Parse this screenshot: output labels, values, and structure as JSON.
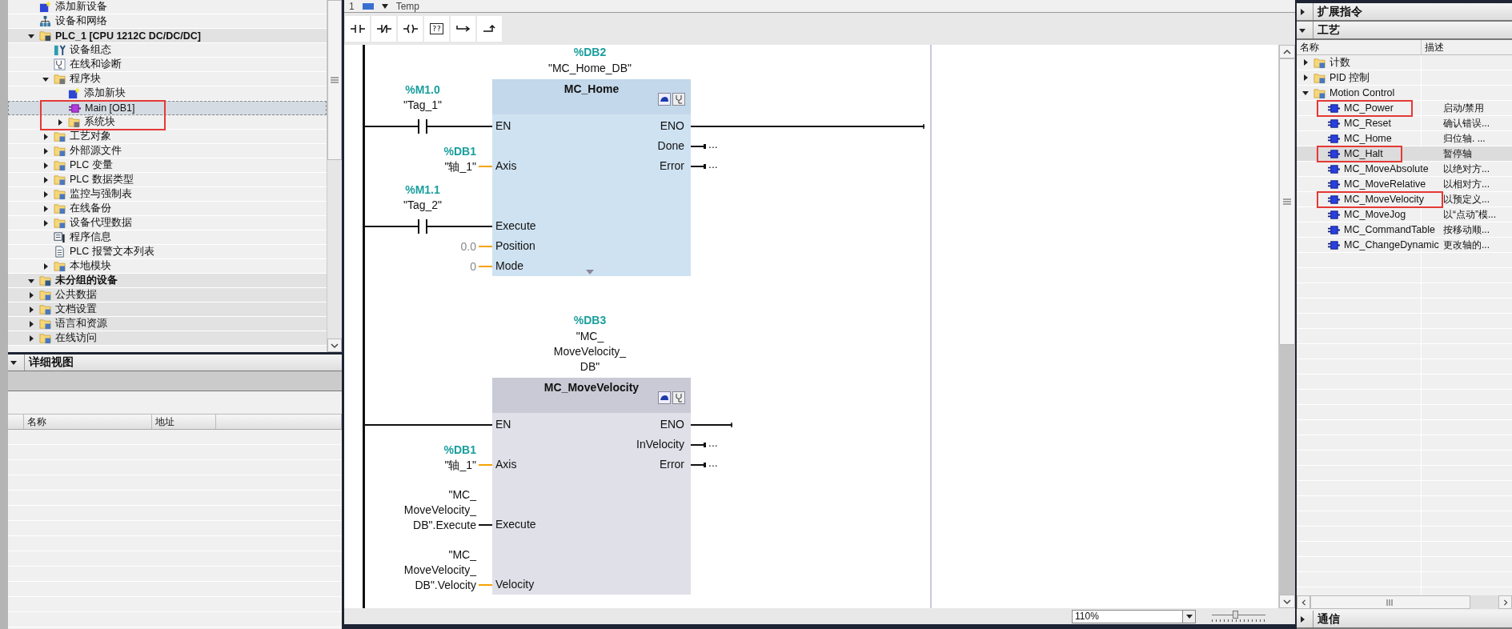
{
  "project_tree": {
    "items": [
      {
        "label": "添加新设备",
        "kind": "add",
        "selected": false
      },
      {
        "label": "设备和网络",
        "kind": "network",
        "selected": false
      },
      {
        "label": "PLC_1 [CPU 1212C DC/DC/DC]",
        "kind": "plc",
        "expanded": true,
        "selected": false,
        "children": [
          {
            "label": "设备组态",
            "kind": "config",
            "selected": false
          },
          {
            "label": "在线和诊断",
            "kind": "diagnostics",
            "selected": false
          },
          {
            "label": "程序块",
            "kind": "block-folder",
            "expanded": true,
            "selected": false,
            "children": [
              {
                "label": "添加新块",
                "kind": "add",
                "selected": false
              },
              {
                "label": "Main [OB1]",
                "kind": "block",
                "selected": true,
                "annotated": true
              },
              {
                "label": "系统块",
                "kind": "block-folder",
                "expanded": false,
                "selected": false,
                "annotated": true
              }
            ]
          },
          {
            "label": "工艺对象",
            "kind": "folder",
            "expanded": false,
            "selected": false
          },
          {
            "label": "外部源文件",
            "kind": "folder",
            "expanded": false,
            "selected": false
          },
          {
            "label": "PLC 变量",
            "kind": "folder",
            "expanded": false,
            "selected": false
          },
          {
            "label": "PLC 数据类型",
            "kind": "folder",
            "expanded": false,
            "selected": false
          },
          {
            "label": "监控与强制表",
            "kind": "folder",
            "expanded": false,
            "selected": false
          },
          {
            "label": "在线备份",
            "kind": "folder",
            "expanded": false,
            "selected": false
          },
          {
            "label": "设备代理数据",
            "kind": "folder",
            "expanded": false,
            "selected": false
          },
          {
            "label": "程序信息",
            "kind": "info",
            "selected": false
          },
          {
            "label": "PLC 报警文本列表",
            "kind": "document",
            "selected": false
          },
          {
            "label": "本地模块",
            "kind": "folder",
            "expanded": false,
            "selected": false
          }
        ]
      },
      {
        "label": "未分组的设备",
        "kind": "device-group",
        "expanded": true,
        "selected": false
      },
      {
        "label": "公共数据",
        "kind": "folder",
        "expanded": false,
        "selected": false
      },
      {
        "label": "文档设置",
        "kind": "folder",
        "expanded": false,
        "selected": false
      },
      {
        "label": "语言和资源",
        "kind": "folder",
        "expanded": false,
        "selected": false
      },
      {
        "label": "在线访问",
        "kind": "folder",
        "expanded": false,
        "selected": false
      }
    ]
  },
  "details_view": {
    "title": "详细视图",
    "expanded": true,
    "columns": [
      "名称",
      "地址"
    ]
  },
  "editor": {
    "header_row": {
      "number": "1",
      "name": "Temp"
    },
    "toolbar": [
      {
        "kind": "no-contact"
      },
      {
        "kind": "nc-contact"
      },
      {
        "kind": "coil"
      },
      {
        "kind": "empty-box",
        "label": "??"
      },
      {
        "kind": "open-branch"
      },
      {
        "kind": "close-branch"
      }
    ],
    "networks": [
      {
        "instance_address": "%DB2",
        "instance_name": "\"MC_Home_DB\"",
        "block": {
          "title": "MC_Home",
          "selected": true,
          "has_hidden_pins": true,
          "inputs": [
            {
              "pin": "EN",
              "kind": "contact",
              "address": "%M1.0",
              "operand": "\"Tag_1\""
            },
            {
              "pin": "Axis",
              "kind": "value",
              "address": "%DB1",
              "operand": "\"轴_1\""
            },
            {
              "pin": "Execute",
              "kind": "contact",
              "address": "%M1.1",
              "operand": "\"Tag_2\""
            },
            {
              "pin": "Position",
              "kind": "value",
              "operand": "0.0",
              "default": true
            },
            {
              "pin": "Mode",
              "kind": "value",
              "operand": "0",
              "default": true
            }
          ],
          "outputs": [
            {
              "pin": "ENO",
              "kind": "rung"
            },
            {
              "pin": "Done",
              "kind": "stub",
              "operand": "..."
            },
            {
              "pin": "Error",
              "kind": "stub",
              "operand": "..."
            }
          ]
        }
      },
      {
        "instance_address": "%DB3",
        "instance_name": "\"MC_\nMoveVelocity_\nDB\"",
        "block": {
          "title": "MC_MoveVelocity",
          "selected": false,
          "inputs": [
            {
              "pin": "EN",
              "kind": "rail"
            },
            {
              "pin": "Axis",
              "kind": "value",
              "address": "%DB1",
              "operand": "\"轴_1\""
            },
            {
              "pin": "Execute",
              "kind": "bool",
              "operand": "\"MC_\nMoveVelocity_\nDB\".Execute"
            },
            {
              "pin": "Velocity",
              "kind": "value",
              "operand": "\"MC_\nMoveVelocity_\nDB\".Velocity"
            }
          ],
          "outputs": [
            {
              "pin": "ENO",
              "kind": "open"
            },
            {
              "pin": "InVelocity",
              "kind": "stub",
              "operand": "..."
            },
            {
              "pin": "Error",
              "kind": "stub",
              "operand": "..."
            }
          ]
        }
      }
    ],
    "zoom": {
      "value": "110%",
      "level": 0.43
    }
  },
  "instructions": {
    "sections": [
      {
        "title": "扩展指令",
        "expanded": false
      },
      {
        "title": "工艺",
        "expanded": true,
        "columns": [
          "名称",
          "描述"
        ],
        "rows": [
          {
            "name": "计数",
            "kind": "folder",
            "expanded": false,
            "selected": false
          },
          {
            "name": "PID 控制",
            "kind": "folder",
            "expanded": false,
            "selected": false
          },
          {
            "name": "Motion Control",
            "kind": "folder",
            "expanded": true,
            "selected": false,
            "children": [
              {
                "name": "MC_Power",
                "kind": "instruction",
                "description": "启动/禁用",
                "selected": false,
                "annotated": true
              },
              {
                "name": "MC_Reset",
                "kind": "instruction",
                "description": "确认错误...",
                "selected": false
              },
              {
                "name": "MC_Home",
                "kind": "instruction",
                "description": "归位轴. ...",
                "selected": false
              },
              {
                "name": "MC_Halt",
                "kind": "instruction",
                "description": "暂停轴",
                "selected": true,
                "annotated": true
              },
              {
                "name": "MC_MoveAbsolute",
                "kind": "instruction",
                "description": "以绝对方...",
                "selected": false
              },
              {
                "name": "MC_MoveRelative",
                "kind": "instruction",
                "description": "以相对方...",
                "selected": false
              },
              {
                "name": "MC_MoveVelocity",
                "kind": "instruction",
                "description": "以预定义...",
                "selected": false,
                "annotated": true
              },
              {
                "name": "MC_MoveJog",
                "kind": "instruction",
                "description": "以“点动”模...",
                "selected": false
              },
              {
                "name": "MC_CommandTable",
                "kind": "instruction",
                "description": "按移动顺...",
                "selected": false
              },
              {
                "name": "MC_ChangeDynamic",
                "kind": "instruction",
                "description": "更改轴的...",
                "selected": false
              }
            ]
          }
        ]
      },
      {
        "title": "通信",
        "expanded": false
      }
    ]
  }
}
